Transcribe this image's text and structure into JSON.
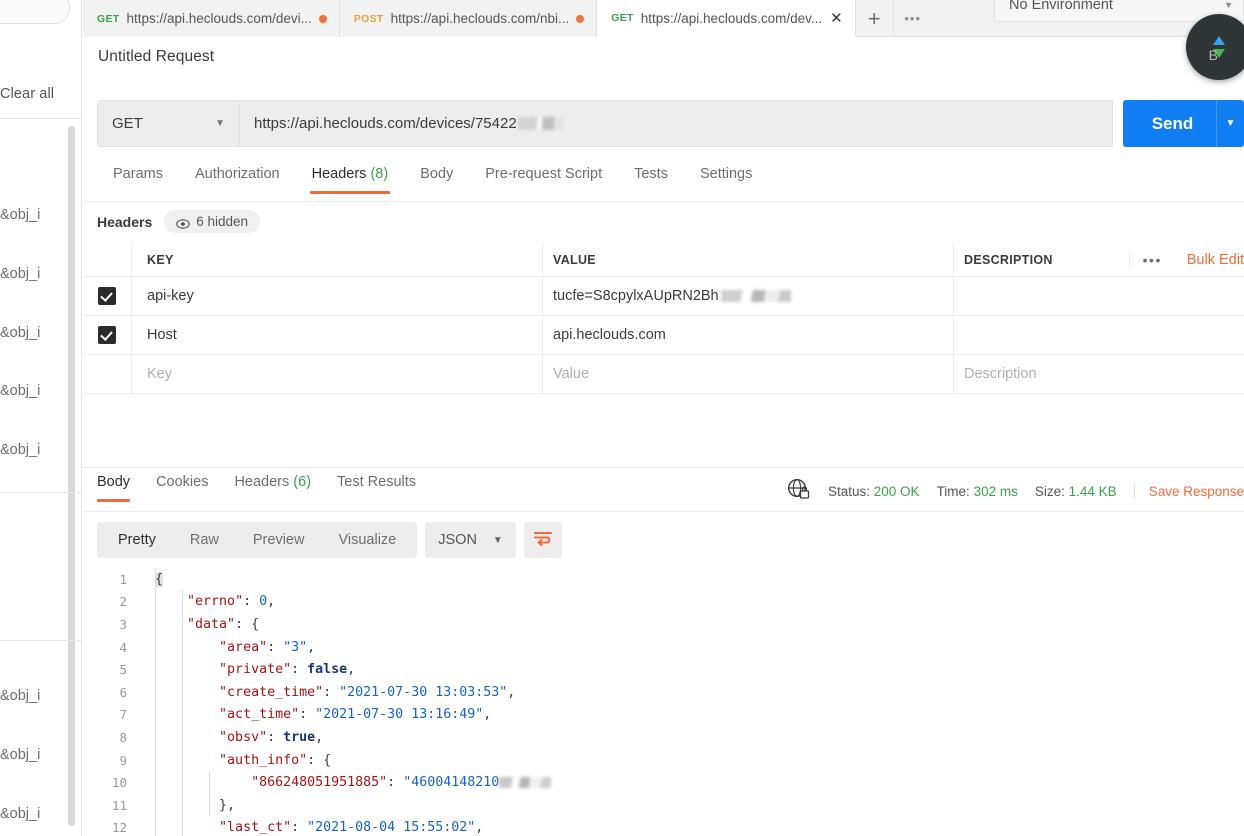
{
  "sidebar": {
    "clear_all_label": "Clear all",
    "history_items": [
      "&obj_i",
      "&obj_i",
      "&obj_i",
      "&obj_i",
      "&obj_i",
      "&obj_i",
      "&obj_i",
      "&obj_i"
    ]
  },
  "tabstrip": {
    "tabs": [
      {
        "method": "GET",
        "name": "https://api.heclouds.com/devi...",
        "unsaved": true,
        "active": false
      },
      {
        "method": "POST",
        "name": "https://api.heclouds.com/nbi...",
        "unsaved": true,
        "active": false
      },
      {
        "method": "GET",
        "name": "https://api.heclouds.com/dev...",
        "unsaved": false,
        "active": true
      }
    ],
    "new_tab_label": "+",
    "more_label": "●●●"
  },
  "environment": {
    "selected": "No Environment",
    "caret": "▼"
  },
  "request": {
    "title": "Untitled Request",
    "method": "GET",
    "method_caret": "▼",
    "url": "https://api.heclouds.com/devices/75422",
    "url_redacted": true,
    "send_label": "Send",
    "send_caret": "▼",
    "tabs": [
      {
        "label": "Params",
        "count": "",
        "selected": false
      },
      {
        "label": "Authorization",
        "count": "",
        "selected": false
      },
      {
        "label": "Headers",
        "count": "(8)",
        "selected": true
      },
      {
        "label": "Body",
        "count": "",
        "selected": false
      },
      {
        "label": "Pre-request Script",
        "count": "",
        "selected": false
      },
      {
        "label": "Tests",
        "count": "",
        "selected": false
      },
      {
        "label": "Settings",
        "count": "",
        "selected": false
      }
    ]
  },
  "headers_section": {
    "label": "Headers",
    "hidden_pill": "6 hidden",
    "columns": [
      "KEY",
      "VALUE",
      "DESCRIPTION"
    ],
    "dots_label": "●●●",
    "bulk_edit_label": "Bulk Edit",
    "rows": [
      {
        "checked": true,
        "key": "api-key",
        "value": "tucfe=S8cpylxAUpRN2Bh",
        "value_redacted": true,
        "description": ""
      },
      {
        "checked": true,
        "key": "Host",
        "value": "api.heclouds.com",
        "value_redacted": false,
        "description": ""
      }
    ],
    "placeholder_row": {
      "key": "Key",
      "value": "Value",
      "description": "Description"
    }
  },
  "response": {
    "tabs": [
      {
        "label": "Body",
        "count": "",
        "selected": true
      },
      {
        "label": "Cookies",
        "count": "",
        "selected": false
      },
      {
        "label": "Headers",
        "count": "(6)",
        "selected": false
      },
      {
        "label": "Test Results",
        "count": "",
        "selected": false
      }
    ],
    "status_label": "Status:",
    "status_value": "200 OK",
    "time_label": "Time:",
    "time_value": "302 ms",
    "size_label": "Size:",
    "size_value": "1.44 KB",
    "save_response_label": "Save Response",
    "viewer": {
      "modes": [
        "Pretty",
        "Raw",
        "Preview",
        "Visualize"
      ],
      "selected_mode": "Pretty",
      "format": "JSON",
      "format_caret": "▼",
      "wrap_icon": "wrap-lines-icon"
    },
    "body_lines": [
      {
        "n": 1,
        "indent": 0,
        "tokens": [
          {
            "t": "punc",
            "v": "{"
          }
        ]
      },
      {
        "n": 2,
        "indent": 1,
        "tokens": [
          {
            "t": "key",
            "v": "\"errno\""
          },
          {
            "t": "punc",
            "v": ": "
          },
          {
            "t": "num",
            "v": "0"
          },
          {
            "t": "punc",
            "v": ","
          }
        ]
      },
      {
        "n": 3,
        "indent": 1,
        "tokens": [
          {
            "t": "key",
            "v": "\"data\""
          },
          {
            "t": "punc",
            "v": ": {"
          }
        ]
      },
      {
        "n": 4,
        "indent": 2,
        "tokens": [
          {
            "t": "key",
            "v": "\"area\""
          },
          {
            "t": "punc",
            "v": ": "
          },
          {
            "t": "str",
            "v": "\"3\""
          },
          {
            "t": "punc",
            "v": ","
          }
        ]
      },
      {
        "n": 5,
        "indent": 2,
        "tokens": [
          {
            "t": "key",
            "v": "\"private\""
          },
          {
            "t": "punc",
            "v": ": "
          },
          {
            "t": "bool",
            "v": "false"
          },
          {
            "t": "punc",
            "v": ","
          }
        ]
      },
      {
        "n": 6,
        "indent": 2,
        "tokens": [
          {
            "t": "key",
            "v": "\"create_time\""
          },
          {
            "t": "punc",
            "v": ": "
          },
          {
            "t": "str",
            "v": "\"2021-07-30 13:03:53\""
          },
          {
            "t": "punc",
            "v": ","
          }
        ]
      },
      {
        "n": 7,
        "indent": 2,
        "tokens": [
          {
            "t": "key",
            "v": "\"act_time\""
          },
          {
            "t": "punc",
            "v": ": "
          },
          {
            "t": "str",
            "v": "\"2021-07-30 13:16:49\""
          },
          {
            "t": "punc",
            "v": ","
          }
        ]
      },
      {
        "n": 8,
        "indent": 2,
        "tokens": [
          {
            "t": "key",
            "v": "\"obsv\""
          },
          {
            "t": "punc",
            "v": ": "
          },
          {
            "t": "bool",
            "v": "true"
          },
          {
            "t": "punc",
            "v": ","
          }
        ]
      },
      {
        "n": 9,
        "indent": 2,
        "tokens": [
          {
            "t": "key",
            "v": "\"auth_info\""
          },
          {
            "t": "punc",
            "v": ": {"
          }
        ]
      },
      {
        "n": 10,
        "indent": 3,
        "tokens": [
          {
            "t": "key",
            "v": "\"866248051951885\""
          },
          {
            "t": "punc",
            "v": ": "
          },
          {
            "t": "str",
            "v": "\"46004148210"
          },
          {
            "t": "redact",
            "v": ""
          }
        ]
      },
      {
        "n": 11,
        "indent": 2,
        "tokens": [
          {
            "t": "punc",
            "v": "},"
          }
        ]
      },
      {
        "n": 12,
        "indent": 2,
        "tokens": [
          {
            "t": "key",
            "v": "\"last_ct\""
          },
          {
            "t": "punc",
            "v": ": "
          },
          {
            "t": "str",
            "v": "\"2021-08-04 15:55:02\""
          },
          {
            "t": "punc",
            "v": ","
          }
        ]
      }
    ]
  },
  "net_widget": {
    "up_icon": "arrow-up-icon",
    "down_icon": "arrow-down-icon",
    "bw_text": "B"
  },
  "colors": {
    "accent_orange": "#f26b3a",
    "send_blue": "#0f7ef0",
    "status_green": "#3aa34c",
    "json_key": "#a31515",
    "json_string": "#1565c0"
  }
}
